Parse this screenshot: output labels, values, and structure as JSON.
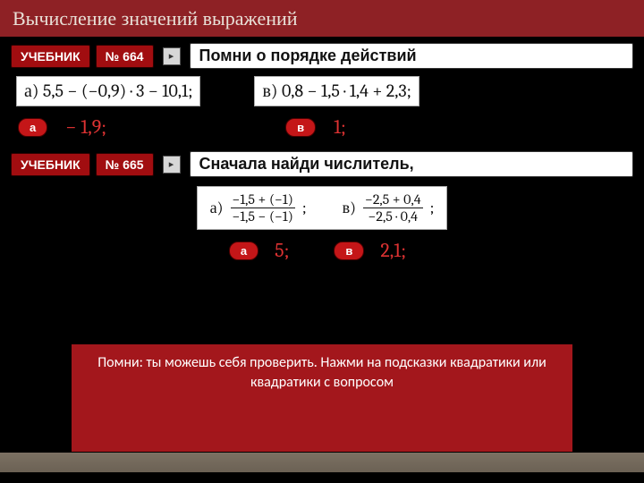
{
  "colors": {
    "accent": "#8e2125",
    "red": "#a10d10",
    "pill": "#c41618",
    "answer": "#dc3232"
  },
  "title": "Вычисление значений выражений",
  "task664": {
    "uchebnik": "УЧЕБНИК",
    "number": "№ 664",
    "hint": "Помни о порядке действий",
    "exprA": "а) 5,5 − (−0,9) · 3 − 10,1;",
    "exprV": "в) 0,8 − 1,5 · 1,4 + 2,3;",
    "pillA": "а",
    "answerA": "− 1,9;",
    "pillV": "в",
    "answerV": "1;"
  },
  "task665": {
    "uchebnik": "УЧЕБНИК",
    "number": "№ 665",
    "hint": "Сначала найди числитель,",
    "fracA_label": "а)",
    "fracA_num": "−1,5 + (−1)",
    "fracA_den": "−1,5 − (−1)",
    "fracV_label": "в)",
    "fracV_num": "−2,5 + 0,4",
    "fracV_den": "−2,5 · 0,4",
    "semicolon": ";",
    "pillA": "а",
    "answerA": "5;",
    "pillV": "в",
    "answerV": "2,1;"
  },
  "reminder": "Помни: ты можешь себя проверить. Нажми на подсказки квадратики или квадратики с вопросом",
  "icons": {
    "toggle_glyph": "▸"
  }
}
